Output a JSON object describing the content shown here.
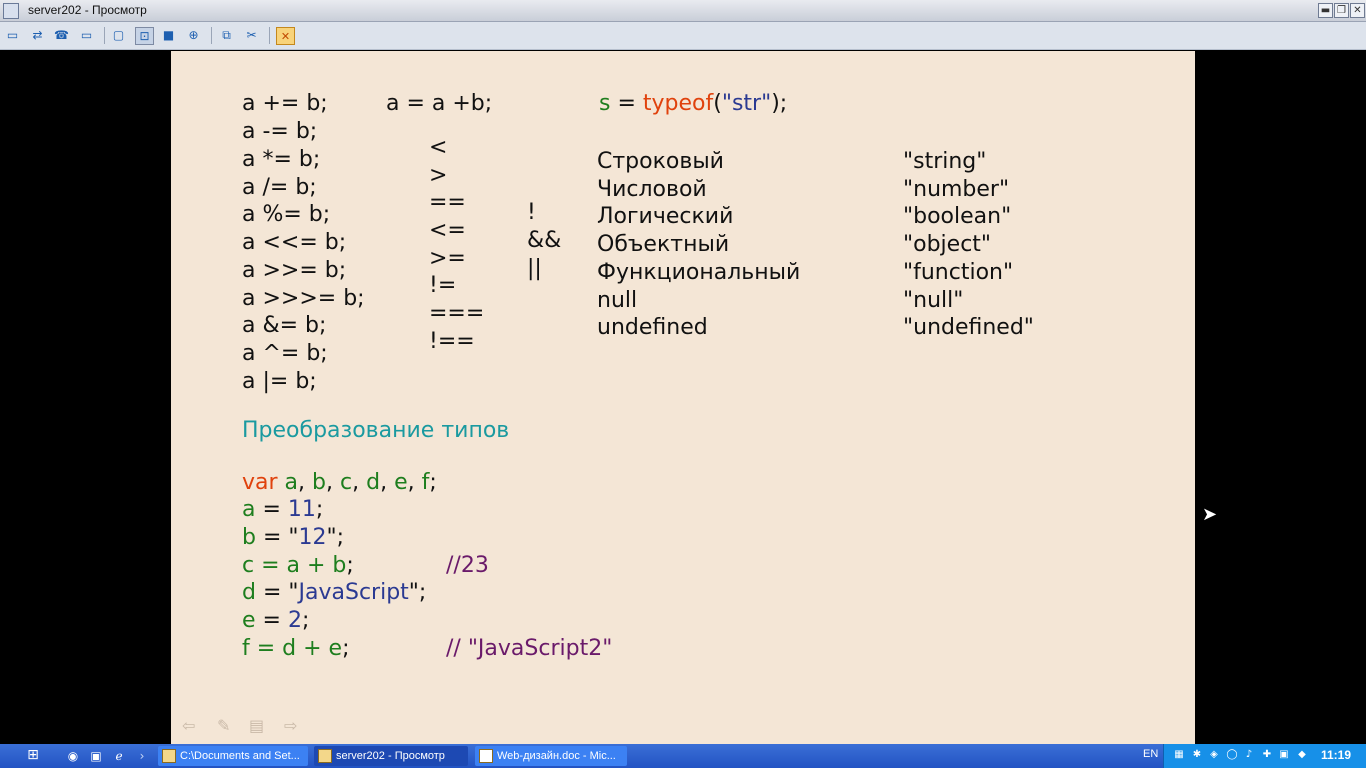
{
  "window": {
    "title": "server202 - Просмотр",
    "controls": {
      "minimize": "▬",
      "restore": "❐",
      "close": "✕"
    }
  },
  "toolbar": {
    "icons": [
      "display-icon",
      "transfer-icon",
      "phone-icon",
      "chat-icon",
      "window-icon",
      "fit-screen-icon",
      "fullscreen-icon",
      "scale-icon",
      "copy-icon",
      "tools-icon",
      "close-session-icon"
    ]
  },
  "slide": {
    "assign_ops": [
      "a += b;",
      "a -= b;",
      "a *= b;",
      "a /= b;",
      "a %= b;",
      "a <<= b;",
      "a >>= b;",
      "a >>>= b;",
      "a &= b;",
      "a ^= b;",
      "a |= b;"
    ],
    "assign_example": "a = a +b;",
    "typeof_line": {
      "var": "s",
      "eq": " = ",
      "fn": "typeof",
      "open": "(",
      "arg": "\"str\"",
      "close": ");"
    },
    "compare_ops": [
      "<",
      ">",
      "==",
      "<=",
      ">=",
      "!=",
      "===",
      "!=="
    ],
    "logic_ops": [
      "!",
      "&&",
      "||"
    ],
    "types": [
      {
        "name": "Строковый",
        "value": "\"string\""
      },
      {
        "name": "Числовой",
        "value": "\"number\""
      },
      {
        "name": "Логический",
        "value": "\"boolean\""
      },
      {
        "name": "Объектный",
        "value": "\"object\""
      },
      {
        "name": "Функциональный",
        "value": "\"function\""
      },
      {
        "name": "null",
        "value": "\"null\""
      },
      {
        "name": "undefined",
        "value": "\"undefined\""
      }
    ],
    "heading": "Преобразование типов",
    "code": {
      "line1": {
        "kw": "var",
        "a": "a",
        ", ": ", ",
        "b": "b",
        "c": "c",
        "d": "d",
        "e": "e",
        "f": "f",
        "end": ";"
      },
      "line2": {
        "var": "a",
        "eq": " = ",
        "val": "11",
        "end": ";"
      },
      "line3": {
        "var": "b",
        "eq": " = \"",
        "val": "12",
        "end": "\";"
      },
      "line4": {
        "expr": "c = a + b",
        "end": ";",
        "comment": "//23"
      },
      "line5": {
        "var": "d",
        "eq": " = \"",
        "val": "JavaScript",
        "end": "\";"
      },
      "line6": {
        "var": "e",
        "eq": " = ",
        "val": "2",
        "end": ";"
      },
      "line7": {
        "expr": "f = d + e",
        "end": ";",
        "comment": "// \"JavaScript2\""
      }
    },
    "nav": {
      "prev": "⇦",
      "pen": "✎",
      "menu": "▤",
      "next": "⇨"
    }
  },
  "taskbar": {
    "tasks": [
      {
        "label": "C:\\Documents and Set...",
        "active": false
      },
      {
        "label": "server202 - Просмотр",
        "active": true
      },
      {
        "label": "Web-дизайн.doc - Mic...",
        "active": false
      }
    ],
    "lang": "EN",
    "clock": "11:19"
  }
}
